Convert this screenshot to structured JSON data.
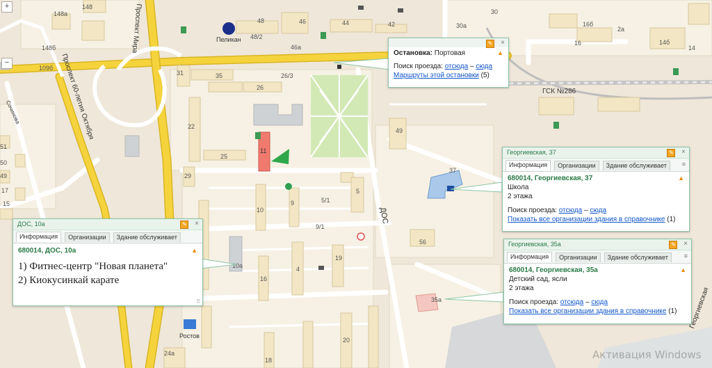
{
  "map": {
    "colors": {
      "land": "#efe7d9",
      "block": "#f6f1e4",
      "building": "#f2e6c4",
      "building_edge": "#d8c79e",
      "grey_building": "#cfd2d4",
      "park": "#d2e9b5",
      "trunk_road": "#f5d33c",
      "road": "#ffffff",
      "rail": "#b6b6b6",
      "selected": "#f07a6e",
      "marker": "#2ea84b"
    },
    "street_labels": [
      "Проспект Мира",
      "Проспект 60-летия Октября",
      "ДОС",
      "Георгиевская",
      "ГСК №286",
      "Ростов",
      "Пеликан",
      "Сочинова"
    ],
    "house_numbers": [
      {
        "id": "h148",
        "text": "148"
      },
      {
        "id": "h148a",
        "text": "148а"
      },
      {
        "id": "h148b",
        "text": "148б"
      },
      {
        "id": "h109b",
        "text": "109б"
      },
      {
        "id": "h48",
        "text": "48"
      },
      {
        "id": "h48_2",
        "text": "48/2"
      },
      {
        "id": "h46",
        "text": "46"
      },
      {
        "id": "h46a",
        "text": "46а"
      },
      {
        "id": "h44",
        "text": "44"
      },
      {
        "id": "h42",
        "text": "42"
      },
      {
        "id": "h30a",
        "text": "30а"
      },
      {
        "id": "h30",
        "text": "30"
      },
      {
        "id": "h16b",
        "text": "16б"
      },
      {
        "id": "h16",
        "text": "16"
      },
      {
        "id": "h2a",
        "text": "2а"
      },
      {
        "id": "h14b",
        "text": "14б"
      },
      {
        "id": "h14",
        "text": "14"
      },
      {
        "id": "h31",
        "text": "31"
      },
      {
        "id": "h35",
        "text": "35"
      },
      {
        "id": "h26_3",
        "text": "26/3"
      },
      {
        "id": "h26",
        "text": "26"
      },
      {
        "id": "h22",
        "text": "22"
      },
      {
        "id": "h25",
        "text": "25"
      },
      {
        "id": "h11",
        "text": "11"
      },
      {
        "id": "h29",
        "text": "29"
      },
      {
        "id": "h49",
        "text": "49"
      },
      {
        "id": "h37",
        "text": "37"
      },
      {
        "id": "h5",
        "text": "5"
      },
      {
        "id": "h5_1",
        "text": "5/1"
      },
      {
        "id": "h10",
        "text": "10"
      },
      {
        "id": "h9",
        "text": "9"
      },
      {
        "id": "h9_1",
        "text": "9/1"
      },
      {
        "id": "h56",
        "text": "56"
      },
      {
        "id": "h10a",
        "text": "10а"
      },
      {
        "id": "h16s",
        "text": "16"
      },
      {
        "id": "h4",
        "text": "4"
      },
      {
        "id": "h19",
        "text": "19"
      },
      {
        "id": "h35a",
        "text": "35а"
      },
      {
        "id": "h18",
        "text": "18"
      },
      {
        "id": "h20",
        "text": "20"
      },
      {
        "id": "h24a",
        "text": "24а"
      },
      {
        "id": "h51",
        "text": "51"
      },
      {
        "id": "h50",
        "text": "50"
      },
      {
        "id": "h49l",
        "text": "49"
      },
      {
        "id": "h17",
        "text": "17"
      },
      {
        "id": "h15",
        "text": "15"
      }
    ],
    "controls": {
      "zoom_in": "+",
      "zoom_out": "−"
    },
    "watermark": "Активация Windows"
  },
  "stop_balloon": {
    "title_label": "Остановка:",
    "title_value": "Портовая",
    "route_label": "Поиск проезда:",
    "from_link": "отсюда",
    "dash": "–",
    "to_link": "сюда",
    "routes_link": "Маршруты этой остановки",
    "routes_count": "(5)",
    "pin_icon": "pin-icon",
    "close_icon": "close-icon",
    "warn_icon": "warning-icon"
  },
  "balloon_dos": {
    "header": "ДОС, 10а",
    "tabs": [
      "Информация",
      "Организации",
      "Здание обслуживает"
    ],
    "address": "680014, ДОС, 10а",
    "line1": "1) Фитнес-центр \"Новая планета\"",
    "line2": "2) Киокусинкай карате",
    "resize_glyph": "⠿"
  },
  "balloon_g37": {
    "header": "Георгиевская, 37",
    "tabs": [
      "Информация",
      "Организации",
      "Здание обслуживает"
    ],
    "address": "680014, Георгиевская, 37",
    "type": "Школа",
    "floors": "2 этажа",
    "route_label": "Поиск проезда:",
    "from_link": "отсюда",
    "dash": "–",
    "to_link": "сюда",
    "all_orgs_link": "Показать все организации здания в справочнике",
    "all_orgs_count": "(1)"
  },
  "balloon_g35a": {
    "header": "Георгиевская, 35а",
    "tabs": [
      "Информация",
      "Организации",
      "Здание обслуживает"
    ],
    "address": "680014, Георгиевская, 35а",
    "type": "Детский сад, ясли",
    "floors": "2 этажа",
    "route_label": "Поиск проезда:",
    "from_link": "отсюда",
    "dash": "–",
    "to_link": "сюда",
    "all_orgs_link": "Показать все организации здания в справочнике",
    "all_orgs_count": "(1)"
  }
}
